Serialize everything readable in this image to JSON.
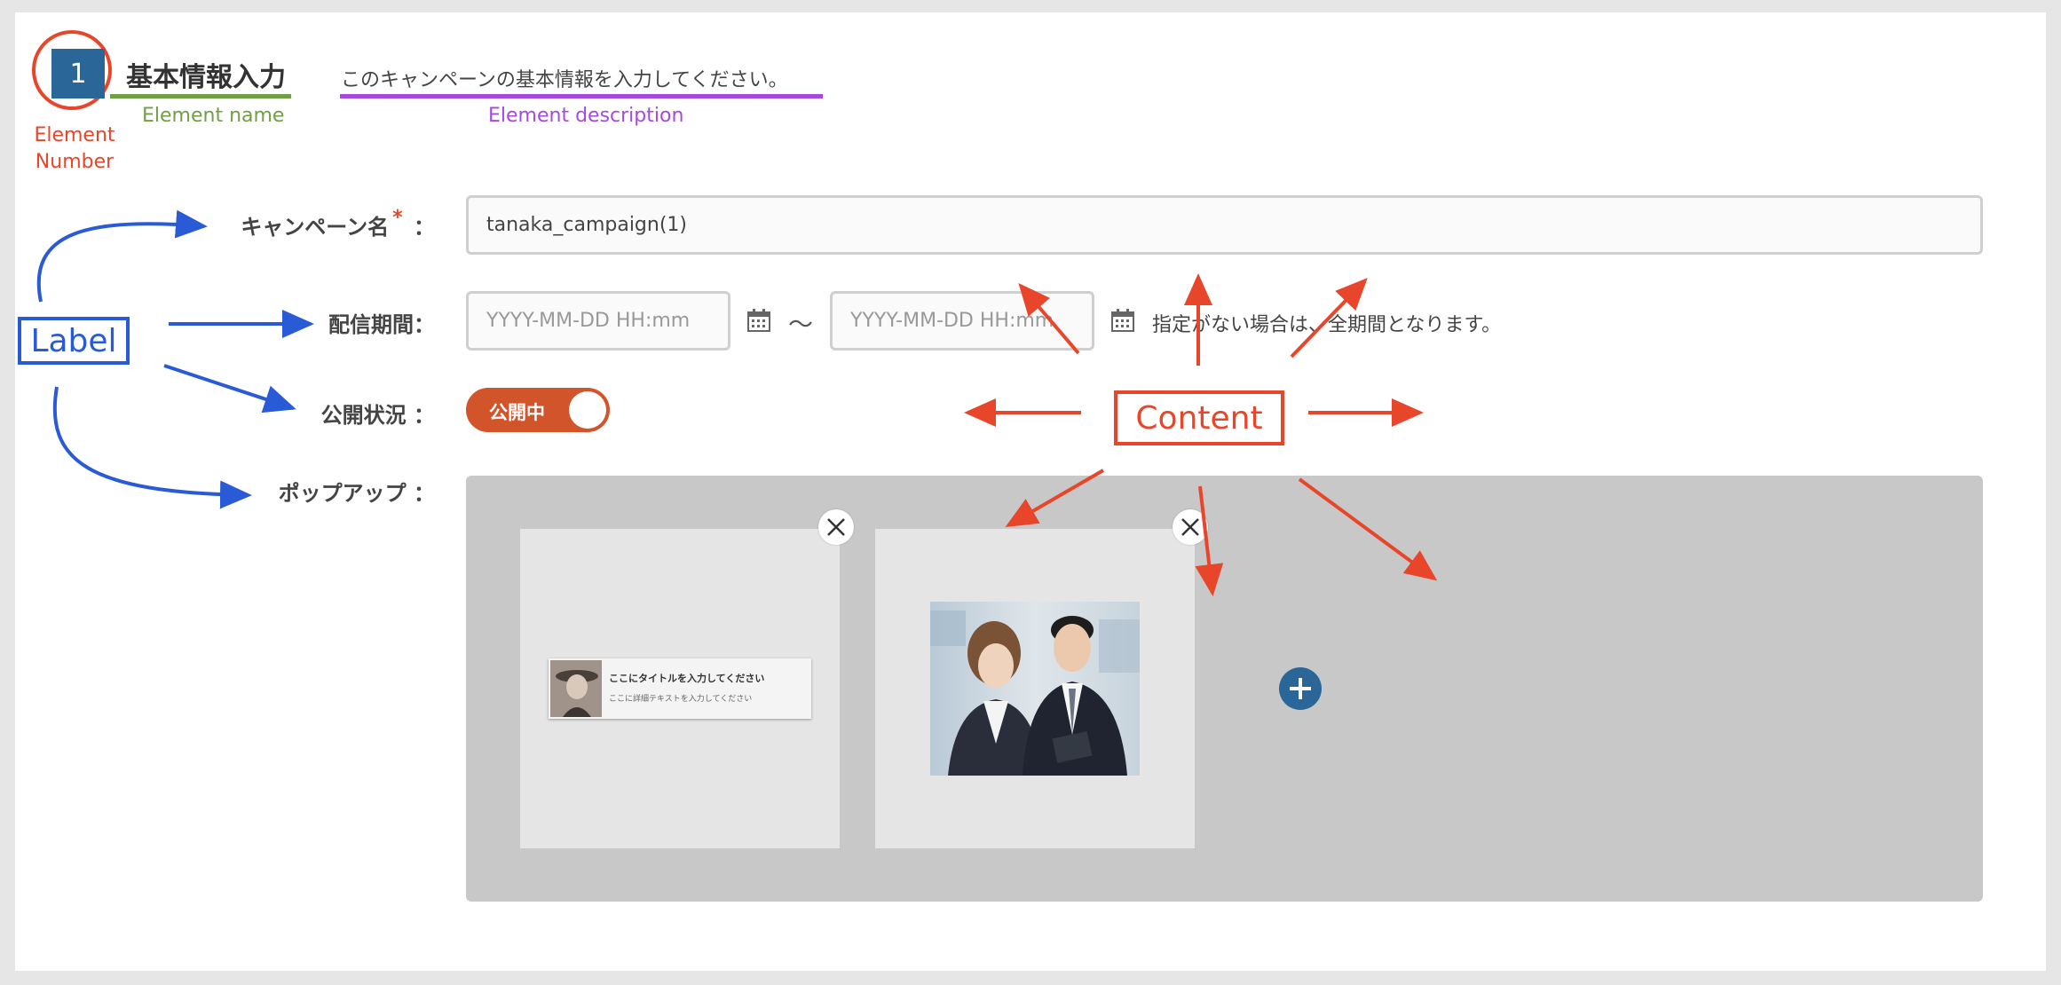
{
  "section": {
    "number": "1",
    "title": "基本情報入力",
    "description": "このキャンペーンの基本情報を入力してください。"
  },
  "annotations": {
    "element_number": "Element\nNumber",
    "element_name": "Element name",
    "element_description": "Element description",
    "label": "Label",
    "content": "Content"
  },
  "fields": {
    "campaign_name": {
      "label": "キャンペーン名",
      "required_mark": "*",
      "colon": "：",
      "value": "tanaka_campaign(1)"
    },
    "delivery_period": {
      "label": "配信期間：",
      "start_placeholder": "YYYY-MM-DD HH:mm",
      "end_placeholder": "YYYY-MM-DD HH:mm",
      "separator": "〜",
      "hint": "指定がない場合は、全期間となります。"
    },
    "publish_status": {
      "label": "公開状況 ：",
      "toggle_label": "公開中",
      "on": true
    },
    "popup": {
      "label": "ポップアップ ：",
      "banner_title": "ここにタイトルを入力してください",
      "banner_text": "ここに詳細テキストを入力してください"
    }
  },
  "colors": {
    "accent_red": "#e8462a",
    "label_blue": "#2a5bd6",
    "badge_blue": "#2b6699",
    "toggle_orange": "#d2542b",
    "name_green": "#6fa043",
    "desc_purple": "#a54ae0"
  },
  "icons": [
    "calendar-icon",
    "close-icon",
    "plus-icon"
  ]
}
